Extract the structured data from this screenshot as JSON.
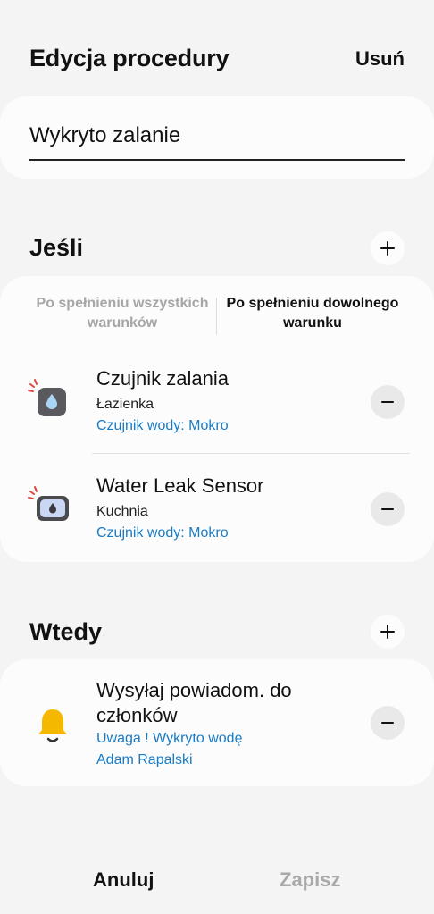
{
  "header": {
    "title": "Edycja procedury",
    "delete_label": "Usuń"
  },
  "name_field": {
    "value": "Wykryto zalanie"
  },
  "if_section": {
    "title": "Jeśli",
    "toggle": {
      "all_label_line1": "Po spełnieniu wszystkich",
      "all_label_line2": "warunków",
      "any_label_line1": "Po spełnieniu dowolnego",
      "any_label_line2": "warunku",
      "selected": "any"
    },
    "conditions": [
      {
        "title": "Czujnik zalania",
        "room": "Łazienka",
        "state": "Czujnik wody: Mokro",
        "icon": "water-drop-sensor-icon"
      },
      {
        "title": "Water Leak Sensor",
        "room": "Kuchnia",
        "state": "Czujnik wody: Mokro",
        "icon": "water-leak-sensor-icon"
      }
    ]
  },
  "then_section": {
    "title": "Wtedy",
    "actions": [
      {
        "title_line1": "Wysyłaj powiadom. do",
        "title_line2": "członków",
        "message": "Uwaga ! Wykryto wodę",
        "recipient": "Adam Rapalski",
        "icon": "bell-icon"
      }
    ]
  },
  "footer": {
    "cancel_label": "Anuluj",
    "save_label": "Zapisz"
  },
  "colors": {
    "background": "#f4f4f4",
    "card": "#fcfcfc",
    "link": "#1a7bc4",
    "inactive": "#a6a6a6",
    "alert_red": "#e0463c",
    "bell_yellow": "#f5b800"
  }
}
